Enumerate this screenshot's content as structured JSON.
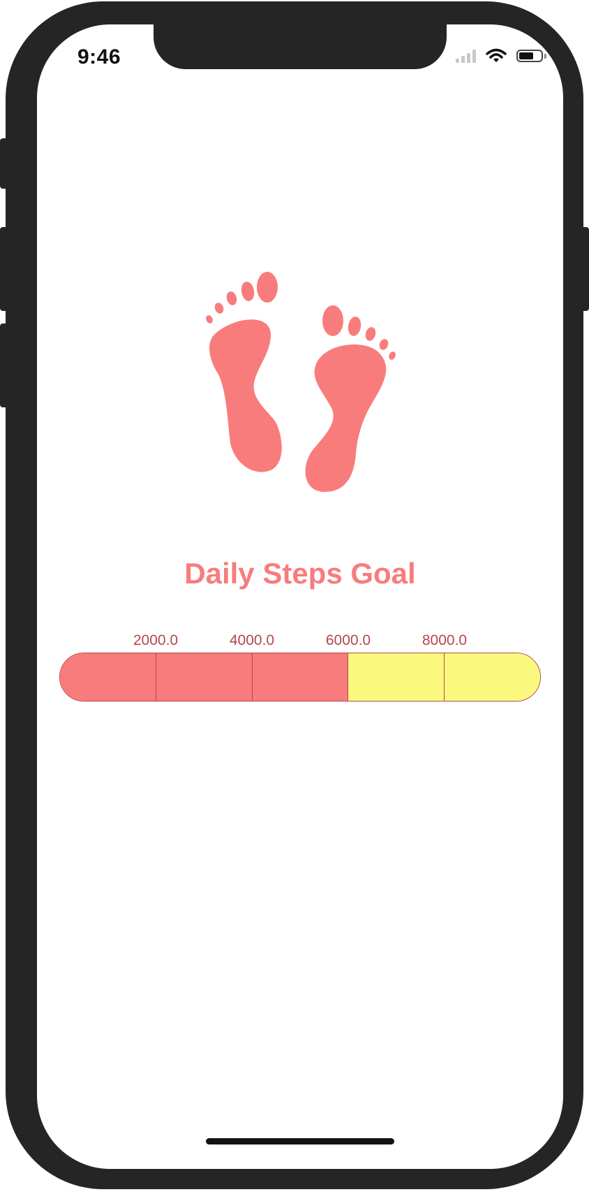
{
  "status_bar": {
    "time": "9:46",
    "signal_bars": 4,
    "signal_active_bars": 0
  },
  "icon": {
    "name": "footprints-icon",
    "color": "#f87c7c"
  },
  "title": "Daily Steps Goal",
  "goal_slider": {
    "ticks": [
      "2000.0",
      "4000.0",
      "6000.0",
      "8000.0"
    ],
    "min": 0,
    "max": 10000,
    "value": 6000,
    "filled_color": "#f87c7c",
    "empty_color": "#fbf87e",
    "border_color": "#b5474b"
  }
}
